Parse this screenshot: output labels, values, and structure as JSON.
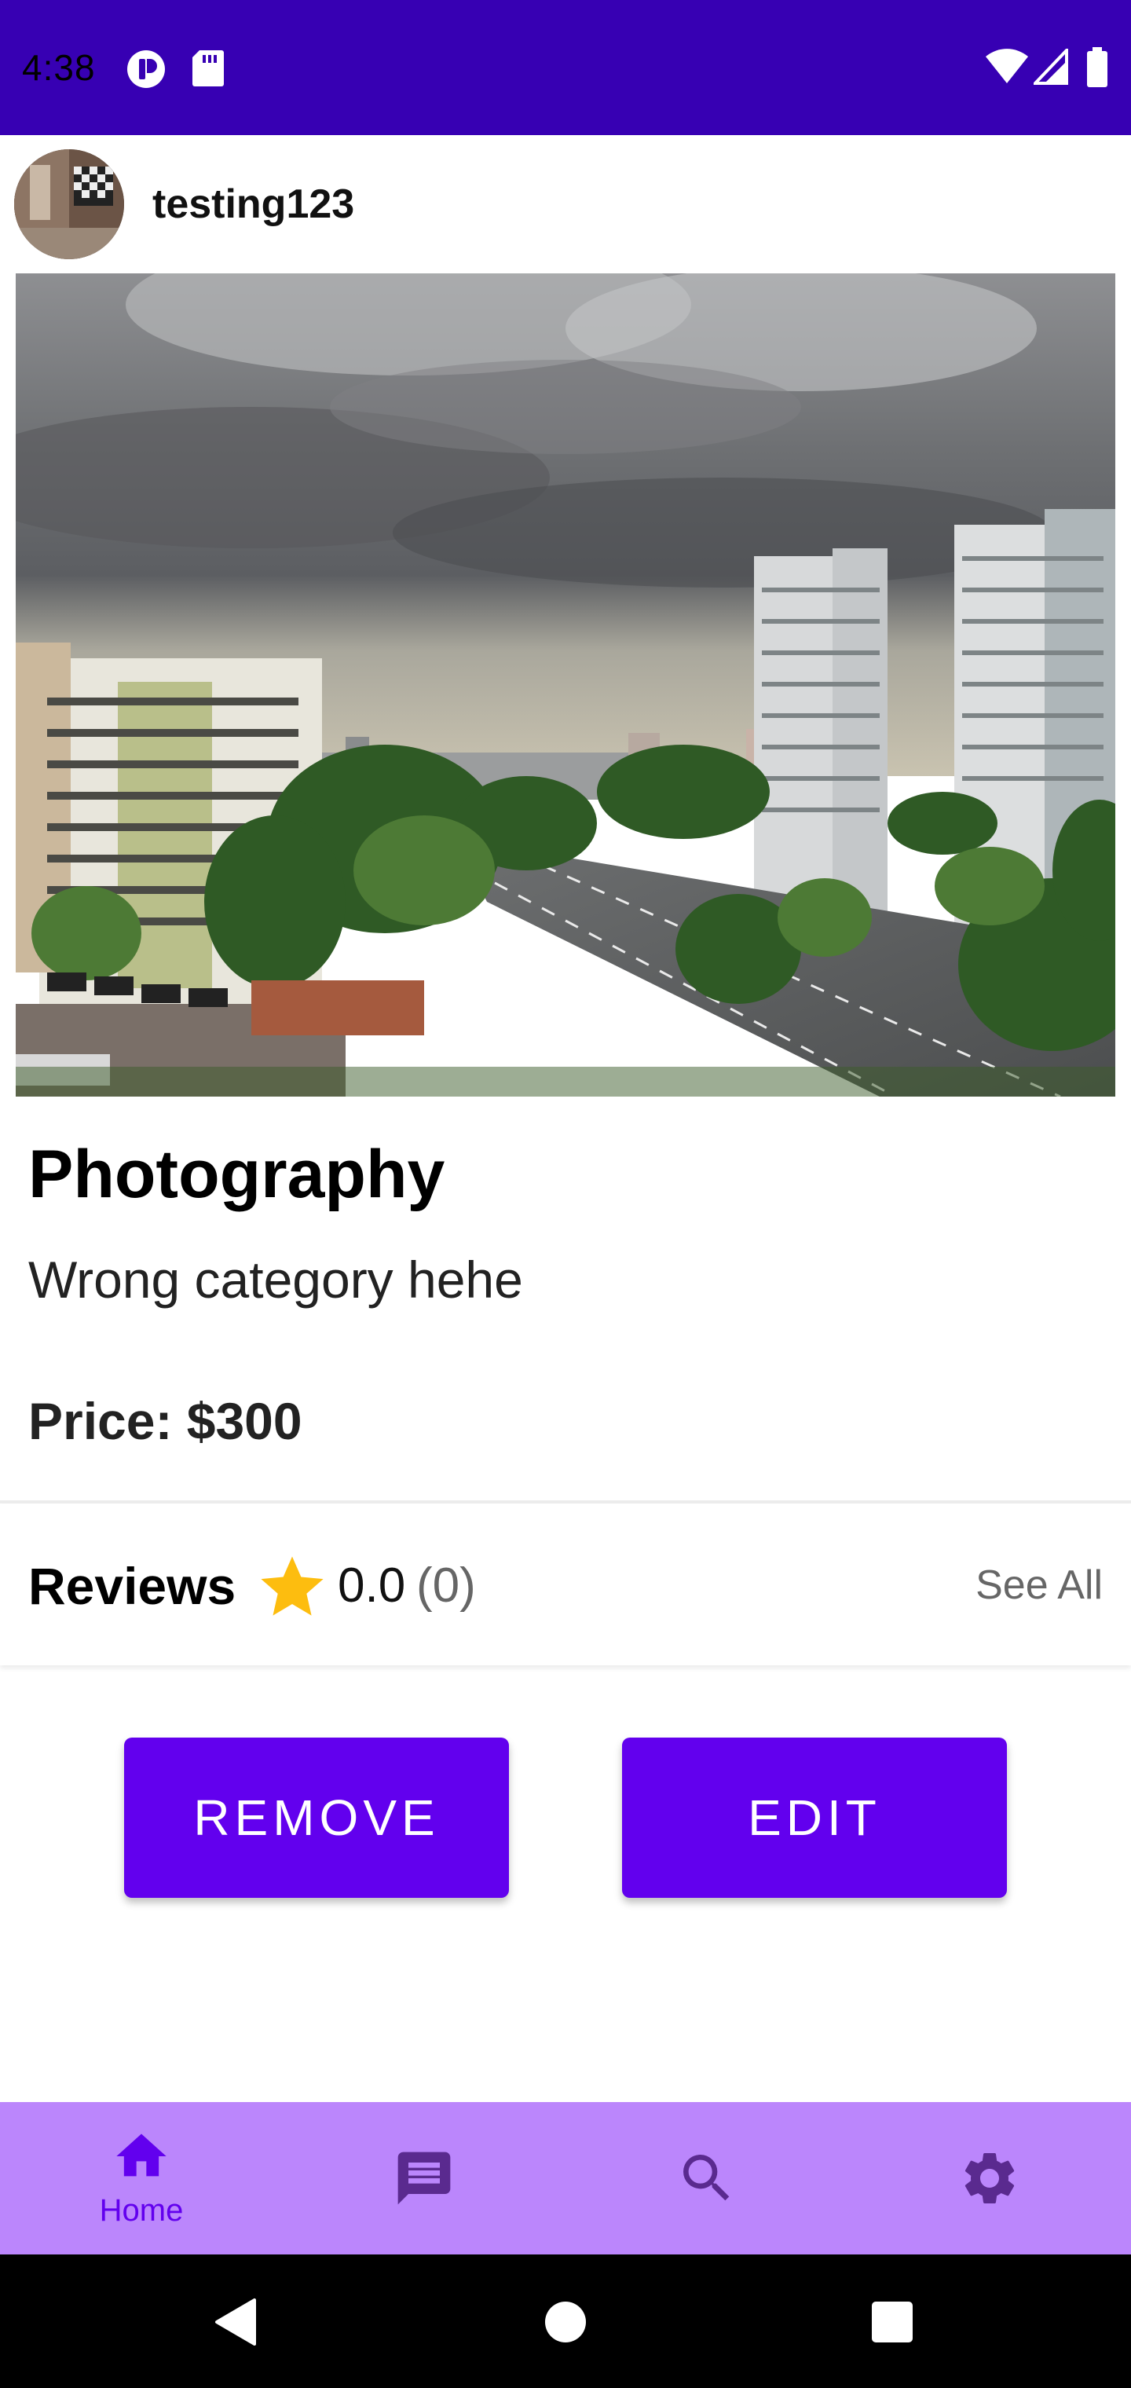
{
  "status_bar": {
    "time": "4:38",
    "background": "#3700b3"
  },
  "post": {
    "username": "testing123",
    "title": "Photography",
    "description": "Wrong category hehe",
    "price": "Price: $300"
  },
  "reviews": {
    "label": "Reviews",
    "rating": "0.0",
    "count": "(0)",
    "see_all": "See All",
    "star_color": "#fdbd0f"
  },
  "actions": {
    "remove_label": "REMOVE",
    "edit_label": "EDIT",
    "color": "#6200ee"
  },
  "bottom_nav": {
    "background": "#bb86fc",
    "items": [
      {
        "icon": "home-icon",
        "label": "Home",
        "selected": true
      },
      {
        "icon": "message-icon",
        "label": "",
        "selected": false
      },
      {
        "icon": "search-icon",
        "label": "",
        "selected": false
      },
      {
        "icon": "gear-icon",
        "label": "",
        "selected": false
      }
    ]
  },
  "system_nav": {
    "icons": [
      "back-icon",
      "home-circle-icon",
      "recents-icon"
    ]
  }
}
